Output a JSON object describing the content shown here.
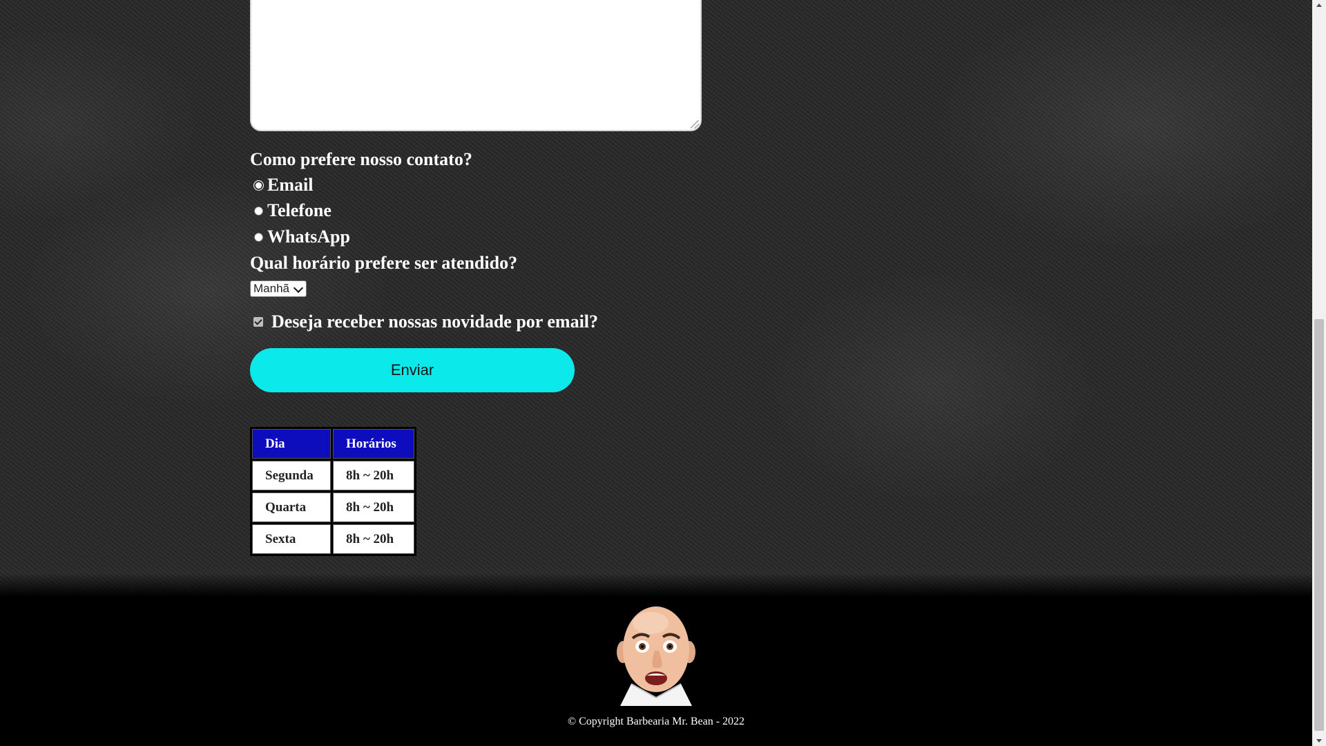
{
  "form": {
    "contact_question": "Como prefere nosso contato?",
    "contact_options": [
      {
        "label": "Email",
        "selected": false
      },
      {
        "label": "Telefone",
        "selected": false
      },
      {
        "label": "WhatsApp",
        "selected": false
      }
    ],
    "time_question": "Qual horário prefere ser atendido?",
    "time_selected": "Manhã",
    "newsletter_label": "Deseja receber nossas novidade por email?",
    "newsletter_checked": true,
    "submit_label": "Enviar"
  },
  "schedule": {
    "headers": [
      "Dia",
      "Horários"
    ],
    "rows": [
      [
        "Segunda",
        "8h ~ 20h"
      ],
      [
        "Quarta",
        "8h ~ 20h"
      ],
      [
        "Sexta",
        "8h ~ 20h"
      ]
    ]
  },
  "footer": {
    "copyright": "© Copyright Barbearia Mr. Bean - 2022"
  },
  "colors": {
    "submit_button": "#0ce9ea",
    "table_header": "#0d0dbd",
    "footer_bg": "#000000"
  }
}
